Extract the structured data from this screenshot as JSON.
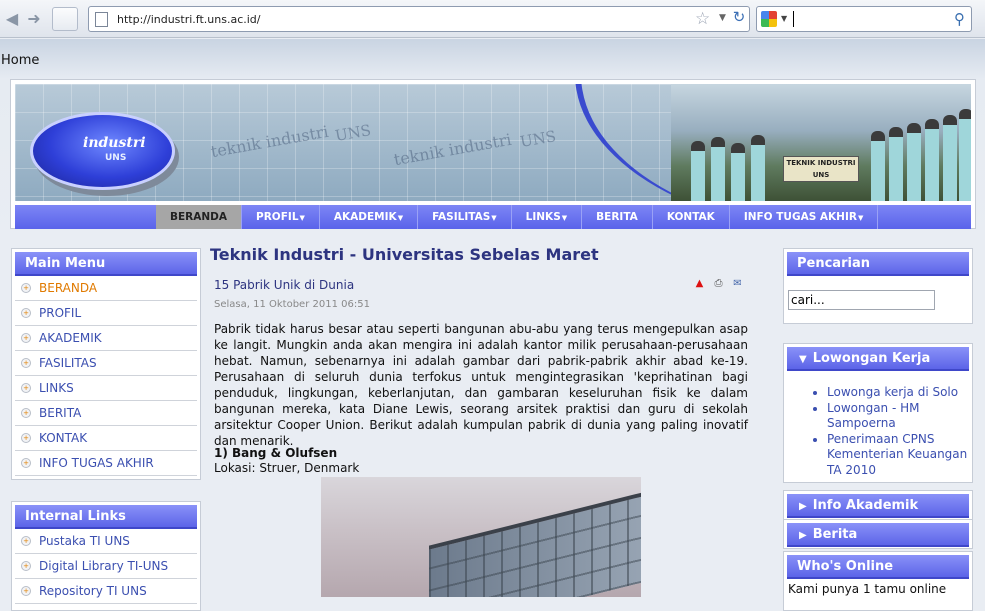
{
  "browser": {
    "url": "http://industri.ft.uns.ac.id/",
    "search_value": ""
  },
  "breadcrumb": "Home",
  "header": {
    "logo_text": "industri",
    "logo_sub": "UNS",
    "watermark": [
      "teknik industri",
      "UNS",
      "teknik industri",
      "UNS"
    ],
    "photo_sign": "TEKNIK INDUSTRI UNS"
  },
  "nav": {
    "items": [
      {
        "label": "BERANDA",
        "dropdown": false
      },
      {
        "label": "PROFIL",
        "dropdown": true
      },
      {
        "label": "AKADEMIK",
        "dropdown": true
      },
      {
        "label": "FASILITAS",
        "dropdown": true
      },
      {
        "label": "LINKS",
        "dropdown": true
      },
      {
        "label": "BERITA",
        "dropdown": false
      },
      {
        "label": "KONTAK",
        "dropdown": false
      },
      {
        "label": "INFO TUGAS AKHIR",
        "dropdown": true
      }
    ]
  },
  "main_menu": {
    "title": "Main Menu",
    "items": [
      "BERANDA",
      "PROFIL",
      "AKADEMIK",
      "FASILITAS",
      "LINKS",
      "BERITA",
      "KONTAK",
      "INFO TUGAS AKHIR"
    ]
  },
  "internal_links": {
    "title": "Internal Links",
    "items": [
      "Pustaka TI UNS",
      "Digital Library TI-UNS",
      "Repository TI UNS"
    ]
  },
  "content": {
    "page_title": "Teknik Industri - Universitas Sebelas Maret",
    "article_title": "15 Pabrik Unik di Dunia",
    "date": "Selasa, 11 Oktober 2011 06:51",
    "body": "Pabrik tidak harus besar atau seperti bangunan abu-abu yang terus mengepulkan asap ke langit. Mungkin anda akan mengira ini adalah kantor milik perusahaan-perusahaan hebat. Namun, sebenarnya ini adalah gambar dari pabrik-pabrik akhir abad ke-19. Perusahaan di seluruh dunia terfokus untuk mengintegrasikan 'keprihatinan bagi penduduk, lingkungan, keberlanjutan, dan gambaran keseluruhan fisik ke dalam bangunan mereka, kata Diane Lewis, seorang arsitek praktisi dan guru di sekolah arsitektur Cooper Union. Berikut adalah kumpulan pabrik di dunia yang paling inovatif dan menarik.",
    "subheading": "1) Bang & Olufsen",
    "location": "Lokasi: Struer, Denmark"
  },
  "right": {
    "search_title": "Pencarian",
    "search_placeholder": "cari...",
    "lowongan_title": "Lowongan Kerja",
    "lowongan_items": [
      "Lowonga kerja di Solo",
      "Lowongan - HM Sampoerna",
      "Penerimaan CPNS Kementerian Keuangan TA 2010"
    ],
    "info_akademik_title": "Info Akademik",
    "berita_title": "Berita",
    "whos_online_title": "Who's Online",
    "whos_online_text": "Kami punya 1 tamu online"
  },
  "colors": {
    "accent": "#5c64e8",
    "link": "#3b4fb0",
    "active_menu": "#e07a00",
    "title": "#2d3480"
  }
}
